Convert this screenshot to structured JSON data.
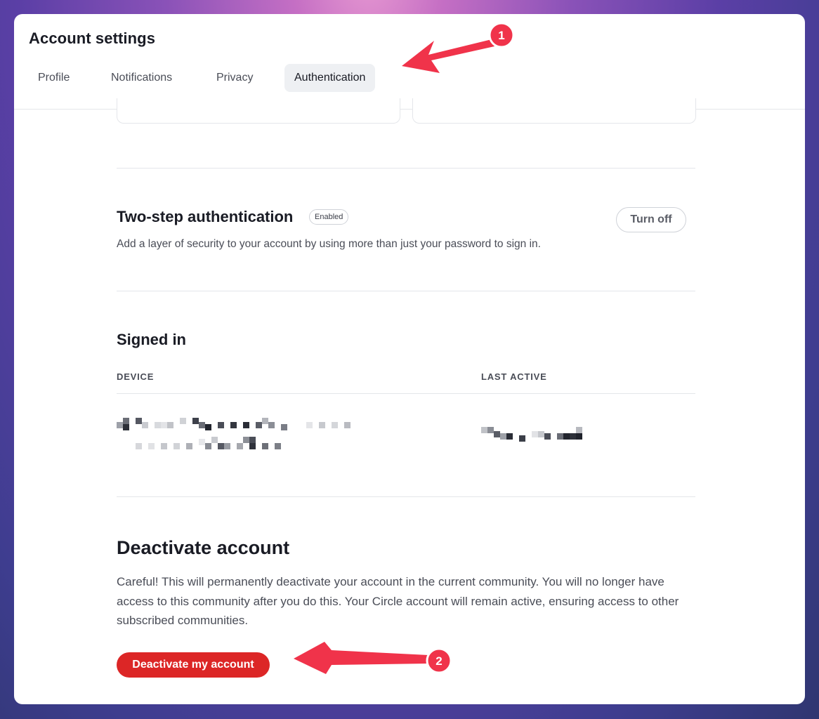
{
  "page": {
    "title": "Account settings"
  },
  "tabs": [
    {
      "label": "Profile",
      "active": false
    },
    {
      "label": "Notifications",
      "active": false
    },
    {
      "label": "Privacy",
      "active": false
    },
    {
      "label": "Authentication",
      "active": true
    }
  ],
  "two_step": {
    "title": "Two-step authentication",
    "badge": "Enabled",
    "description": "Add a layer of security to your account by using more than just your password to sign in.",
    "button_label": "Turn off"
  },
  "signed_in": {
    "title": "Signed in",
    "columns": [
      "DEVICE",
      "LAST ACTIVE"
    ]
  },
  "deactivate": {
    "title": "Deactivate account",
    "description": "Careful! This will permanently deactivate your account in the current community. You will no longer have access to this community after you do this. Your Circle account will remain active, ensuring access to other subscribed communities.",
    "button_label": "Deactivate my account"
  },
  "annotations": [
    {
      "label": "1"
    },
    {
      "label": "2"
    }
  ],
  "colors": {
    "accent_red": "#dc2626",
    "annotation_red": "#f0334a",
    "active_tab_bg": "#eef0f3"
  }
}
